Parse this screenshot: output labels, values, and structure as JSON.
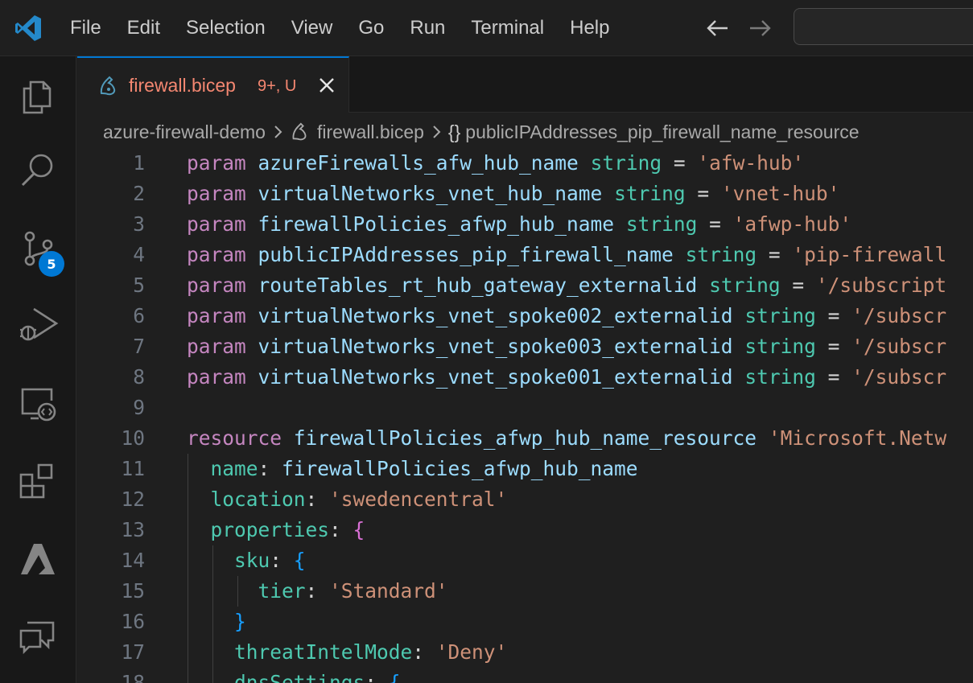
{
  "menu": [
    "File",
    "Edit",
    "Selection",
    "View",
    "Go",
    "Run",
    "Terminal",
    "Help"
  ],
  "activity": {
    "scm_badge": "5"
  },
  "tab": {
    "name": "firewall.bicep",
    "status": "9+, U"
  },
  "breadcrumb": {
    "folder": "azure-firewall-demo",
    "file": "firewall.bicep",
    "symbol_icon": "{}",
    "symbol": "publicIPAddresses_pip_firewall_name_resource"
  },
  "editor": {
    "lines": [
      {
        "n": "1",
        "t": [
          [
            "kw-param",
            "param"
          ],
          [
            "op",
            " "
          ],
          [
            "ident",
            "azureFirewalls_afw_hub_name"
          ],
          [
            "op",
            " "
          ],
          [
            "type",
            "string"
          ],
          [
            "op",
            " = "
          ],
          [
            "str",
            "'afw-hub'"
          ]
        ]
      },
      {
        "n": "2",
        "t": [
          [
            "kw-param",
            "param"
          ],
          [
            "op",
            " "
          ],
          [
            "ident",
            "virtualNetworks_vnet_hub_name"
          ],
          [
            "op",
            " "
          ],
          [
            "type",
            "string"
          ],
          [
            "op",
            " = "
          ],
          [
            "str",
            "'vnet-hub'"
          ]
        ]
      },
      {
        "n": "3",
        "t": [
          [
            "kw-param",
            "param"
          ],
          [
            "op",
            " "
          ],
          [
            "ident",
            "firewallPolicies_afwp_hub_name"
          ],
          [
            "op",
            " "
          ],
          [
            "type",
            "string"
          ],
          [
            "op",
            " = "
          ],
          [
            "str",
            "'afwp-hub'"
          ]
        ]
      },
      {
        "n": "4",
        "t": [
          [
            "kw-param",
            "param"
          ],
          [
            "op",
            " "
          ],
          [
            "ident",
            "publicIPAddresses_pip_firewall_name"
          ],
          [
            "op",
            " "
          ],
          [
            "type",
            "string"
          ],
          [
            "op",
            " = "
          ],
          [
            "str",
            "'pip-firewall"
          ]
        ]
      },
      {
        "n": "5",
        "t": [
          [
            "kw-param",
            "param"
          ],
          [
            "op",
            " "
          ],
          [
            "ident",
            "routeTables_rt_hub_gateway_externalid"
          ],
          [
            "op",
            " "
          ],
          [
            "type",
            "string"
          ],
          [
            "op",
            " = "
          ],
          [
            "str",
            "'/subscript"
          ]
        ]
      },
      {
        "n": "6",
        "t": [
          [
            "kw-param",
            "param"
          ],
          [
            "op",
            " "
          ],
          [
            "ident",
            "virtualNetworks_vnet_spoke002_externalid"
          ],
          [
            "op",
            " "
          ],
          [
            "type",
            "string"
          ],
          [
            "op",
            " = "
          ],
          [
            "str",
            "'/subscr"
          ]
        ]
      },
      {
        "n": "7",
        "t": [
          [
            "kw-param",
            "param"
          ],
          [
            "op",
            " "
          ],
          [
            "ident",
            "virtualNetworks_vnet_spoke003_externalid"
          ],
          [
            "op",
            " "
          ],
          [
            "type",
            "string"
          ],
          [
            "op",
            " = "
          ],
          [
            "str",
            "'/subscr"
          ]
        ]
      },
      {
        "n": "8",
        "t": [
          [
            "kw-param",
            "param"
          ],
          [
            "op",
            " "
          ],
          [
            "ident",
            "virtualNetworks_vnet_spoke001_externalid"
          ],
          [
            "op",
            " "
          ],
          [
            "type",
            "string"
          ],
          [
            "op",
            " = "
          ],
          [
            "str",
            "'/subscr"
          ]
        ]
      },
      {
        "n": "9",
        "t": []
      },
      {
        "n": "10",
        "t": [
          [
            "kw-res",
            "resource"
          ],
          [
            "op",
            " "
          ],
          [
            "ident",
            "firewallPolicies_afwp_hub_name_resource"
          ],
          [
            "op",
            " "
          ],
          [
            "str",
            "'Microsoft.Netw"
          ]
        ]
      },
      {
        "n": "11",
        "t": [
          [
            "op",
            "  "
          ],
          [
            "prop",
            "name"
          ],
          [
            "op",
            ": "
          ],
          [
            "ident",
            "firewallPolicies_afwp_hub_name"
          ]
        ]
      },
      {
        "n": "12",
        "t": [
          [
            "op",
            "  "
          ],
          [
            "prop",
            "location"
          ],
          [
            "op",
            ": "
          ],
          [
            "str",
            "'swedencentral'"
          ]
        ]
      },
      {
        "n": "13",
        "t": [
          [
            "op",
            "  "
          ],
          [
            "prop",
            "properties"
          ],
          [
            "op",
            ": "
          ],
          [
            "brace1",
            "{"
          ]
        ]
      },
      {
        "n": "14",
        "t": [
          [
            "op",
            "    "
          ],
          [
            "prop",
            "sku"
          ],
          [
            "op",
            ": "
          ],
          [
            "brace2",
            "{"
          ]
        ]
      },
      {
        "n": "15",
        "t": [
          [
            "op",
            "      "
          ],
          [
            "prop",
            "tier"
          ],
          [
            "op",
            ": "
          ],
          [
            "str",
            "'Standard'"
          ]
        ]
      },
      {
        "n": "16",
        "t": [
          [
            "op",
            "    "
          ],
          [
            "brace2",
            "}"
          ]
        ]
      },
      {
        "n": "17",
        "t": [
          [
            "op",
            "    "
          ],
          [
            "prop",
            "threatIntelMode"
          ],
          [
            "op",
            ": "
          ],
          [
            "str",
            "'Deny'"
          ]
        ]
      },
      {
        "n": "18",
        "t": [
          [
            "op",
            "    "
          ],
          [
            "prop",
            "dnsSettings"
          ],
          [
            "op",
            ": "
          ],
          [
            "brace2",
            "{"
          ]
        ]
      }
    ]
  }
}
